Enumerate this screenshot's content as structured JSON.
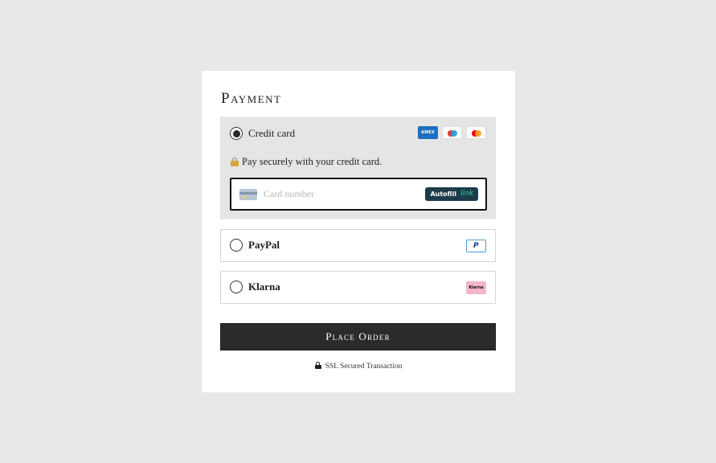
{
  "payment": {
    "title": "Payment",
    "options": [
      {
        "label": "Credit card",
        "selected": true,
        "logos": [
          "amex-logo",
          "maestro-logo",
          "mastercard-logo"
        ],
        "amex_text": "AMEX",
        "secure_text": "Pay securely with your credit card.",
        "card_input": {
          "placeholder": "Card number",
          "value": ""
        },
        "autofill": {
          "label": "Autofill",
          "brand": "link"
        }
      },
      {
        "label": "PayPal",
        "selected": false,
        "logo": "paypal-logo",
        "logo_text": "P"
      },
      {
        "label": "Klarna",
        "selected": false,
        "logo": "klarna-logo",
        "logo_text": "Klarna"
      }
    ],
    "place_order_label": "Place Order",
    "ssl_text": "SSL Secured Transaction"
  },
  "colors": {
    "page_background": "#e8e8e8",
    "panel_background": "#ffffff",
    "selected_option_background": "#e5e5e5",
    "button_background": "#2b2b2b",
    "autofill_background": "#1d3b4a",
    "link_accent": "#33d9a0",
    "klarna_pink": "#f4b6c7",
    "amex_blue": "#1f6ec1"
  },
  "icons": [
    "lock-emoji-icon",
    "card-icon",
    "padlock-icon"
  ]
}
